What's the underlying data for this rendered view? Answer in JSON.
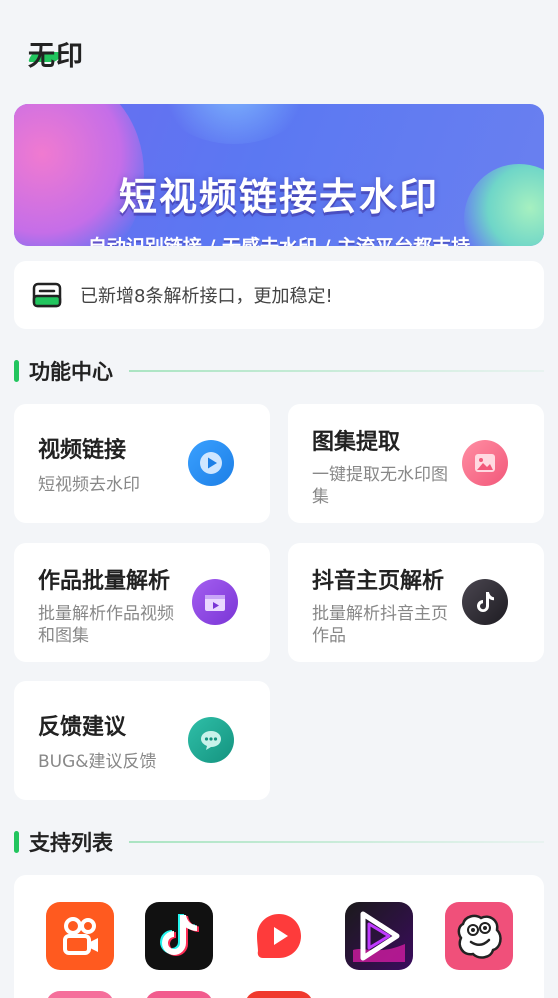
{
  "header": {
    "logo_text": "无印"
  },
  "banner": {
    "title": "短视频链接去水印",
    "subtitle": "自动识别链接 / 无感去水印 / 主流平台都支持"
  },
  "notice": {
    "text": "已新增8条解析接口，更加稳定!",
    "icon": "inbox-tray-icon"
  },
  "features": {
    "section_title": "功能中心",
    "items": [
      {
        "title": "视频链接",
        "desc": "短视频去水印",
        "icon": "video-play-icon",
        "color": "#2f8ff0"
      },
      {
        "title": "图集提取",
        "desc": "一键提取无水印图集",
        "icon": "image-icon",
        "color": "#f76b86"
      },
      {
        "title": "作品批量解析",
        "desc": "批量解析作品视频和图集",
        "icon": "film-clip-icon",
        "color": "#8b45e0"
      },
      {
        "title": "抖音主页解析",
        "desc": "批量解析抖音主页作品",
        "icon": "tiktok-icon",
        "color": "#2b2b33"
      },
      {
        "title": "反馈建议",
        "desc": "BUG&建议反馈",
        "icon": "chat-bubble-icon",
        "color": "#1aa594"
      }
    ]
  },
  "support": {
    "section_title": "支持列表",
    "apps": [
      {
        "name": "kuaishou-app-icon",
        "color": "#ff5a1f"
      },
      {
        "name": "douyin-app-icon",
        "color": "#111111"
      },
      {
        "name": "xigua-app-icon",
        "color": "#ffffff"
      },
      {
        "name": "pipixia-app-icon",
        "color": "#1a1a1a"
      },
      {
        "name": "zuiyou-app-icon",
        "color": "#f0507a"
      }
    ]
  },
  "colors": {
    "accent": "#22c55e",
    "background": "#f3f5f8"
  }
}
